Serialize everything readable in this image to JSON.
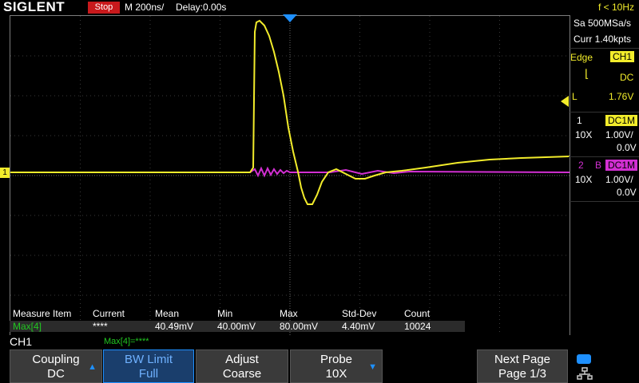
{
  "top": {
    "brand": "SIGLENT",
    "run_state": "Stop",
    "timebase": "M 200ns/",
    "delay": "Delay:0.00s",
    "trigger_freq": "f < 10Hz"
  },
  "acquisition": {
    "sample_rate": "Sa 500MSa/s",
    "memory": "Curr 1.40kpts"
  },
  "trigger": {
    "type": "Edge",
    "source": "CH1",
    "coupling": "DC",
    "level_label": "L",
    "level": "1.76V"
  },
  "ch1": {
    "number": "1",
    "impedance": "DC1M",
    "probe": "10X",
    "scale": "1.00V/",
    "offset": "0.0V"
  },
  "ch2": {
    "number": "2",
    "bw_marker": "B",
    "impedance": "DC1M",
    "probe": "10X",
    "scale": "1.00V/",
    "offset": "0.0V"
  },
  "measure": {
    "headers": [
      "Measure Item",
      "Current",
      "Mean",
      "Min",
      "Max",
      "Std-Dev",
      "Count"
    ],
    "row": [
      "Max[4]",
      "****",
      "40.49mV",
      "40.00mV",
      "80.00mV",
      "4.40mV",
      "10024"
    ]
  },
  "bottom": {
    "channel": "CH1",
    "max_readout": "Max[4]=****"
  },
  "softkeys": [
    {
      "line1": "Coupling",
      "line2": "DC"
    },
    {
      "line1": "BW Limit",
      "line2": "Full"
    },
    {
      "line1": "Adjust",
      "line2": "Coarse"
    },
    {
      "line1": "Probe",
      "line2": "10X"
    },
    {
      "line1": "Next Page",
      "line2": "Page 1/3"
    }
  ],
  "ground_marker": "1",
  "colors": {
    "ch1": "#f2ec2b",
    "ch2": "#d22fd2",
    "accent": "#1e90ff",
    "stop": "#c8191c"
  }
}
